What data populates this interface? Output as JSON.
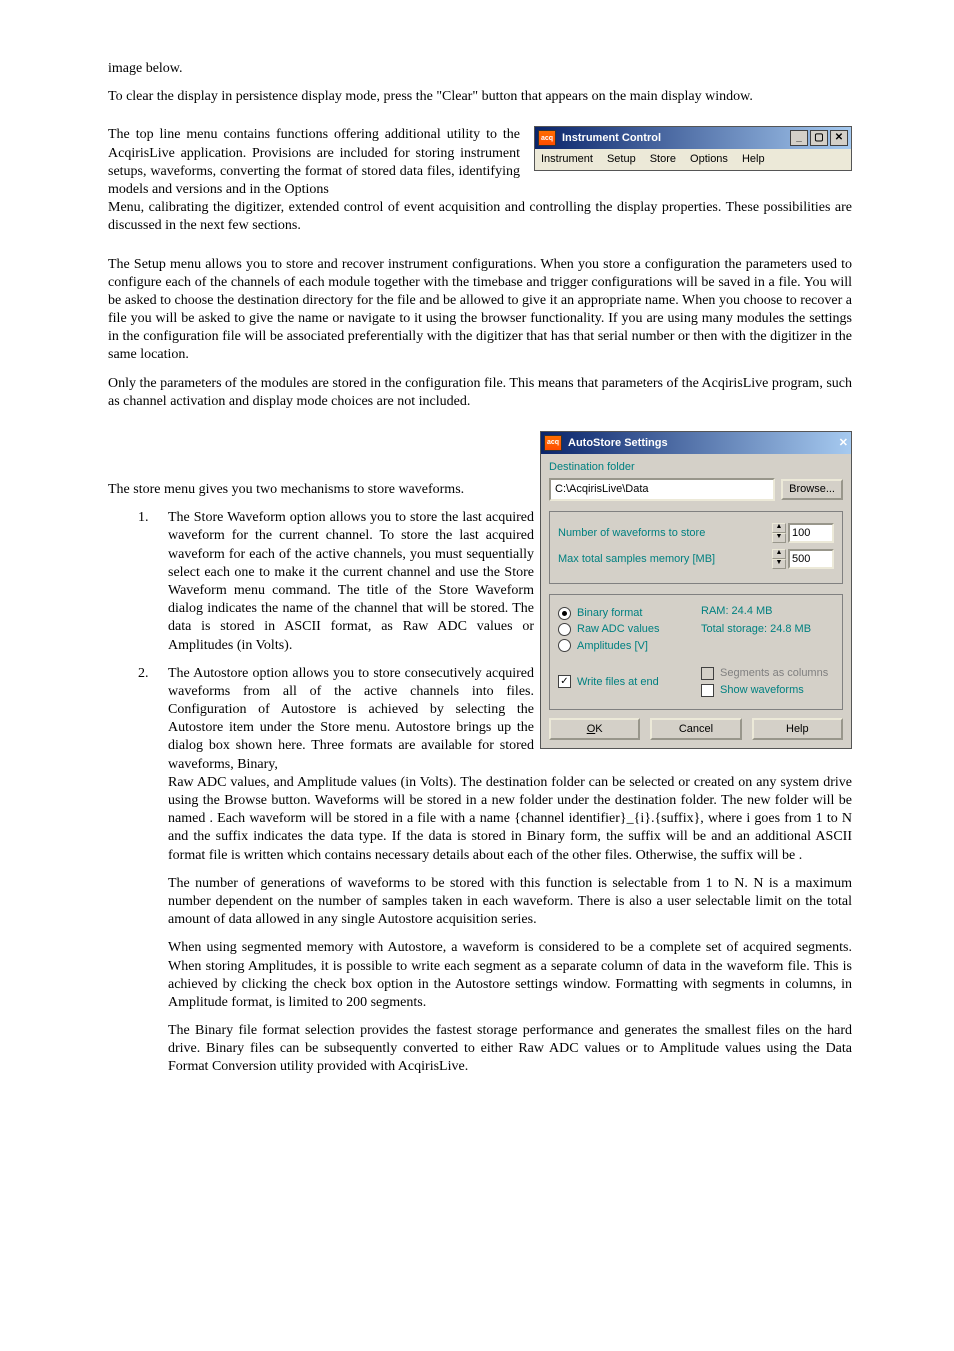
{
  "doc": {
    "p0": "image below.",
    "p1": "To clear the display in persistence display mode, press the \"Clear\" button that appears on the main display window.",
    "p2a": "The top line menu contains functions offering additional utility to the AcqirisLive application. Provisions are included for storing instrument setups, waveforms, converting the format of stored data files, identifying models and versions and in the Options",
    "p2b": "Menu, calibrating the digitizer, extended control of event acquisition and controlling the display properties. These possibilities are discussed in the next few sections.",
    "p3": "The Setup menu allows you to store and recover instrument configurations. When you store a configuration the parameters used to configure each of the channels of each module together with the timebase and trigger configurations will be saved in a file. You will be asked to choose the destination directory for the file and be allowed to give it an appropriate name. When you choose to recover a file you will be asked to give the name or navigate to it using the browser functionality. If you are using many modules the settings in the configuration file will be associated preferentially with the digitizer that has that serial number or then with the digitizer in the same location.",
    "p4": "Only the parameters of the modules are stored in the configuration file. This means that parameters of the AcqirisLive program, such as channel activation and display mode choices are not included.",
    "p5": "The store menu gives you two mechanisms to store waveforms.",
    "li1": "The Store Waveform option allows you to store the last acquired waveform for the current channel. To store the last acquired waveform for each of the active channels, you must sequentially select each one to make it the current channel and use the Store Waveform menu command. The title of the Store Waveform dialog indicates the name of the channel that will be stored. The data is stored in ASCII format, as Raw ADC values or Amplitudes (in Volts).",
    "li2a": "The Autostore option allows you to store consecutively acquired waveforms from all of the active channels into files. Configuration of Autostore is achieved by selecting the Autostore item under the Store menu. Autostore brings up the dialog box shown here. Three formats are available for stored waveforms, Binary,",
    "li2b": "Raw ADC values, and Amplitude values (in Volts). The destination folder can be selected or created on any system drive using the Browse button. Waveforms will be stored in a new folder under the destination folder. The new folder will be named                                         . Each waveform will be stored in a file with a name {channel identifier}_{i}.{suffix}, where i goes from 1 to N and the suffix indicates the data type. If the data is stored in Binary form, the suffix will be         and an additional ASCII format         file is written which contains necessary details about each of the other files. Otherwise, the suffix will be        .",
    "p6": "The number of generations of waveforms to be stored with this function is selectable from 1 to N. N is a maximum number dependent on the number of samples taken in each waveform. There is also a user selectable limit on the total amount of data allowed in any single Autostore acquisition series.",
    "p7": "When using segmented memory with Autostore, a waveform is considered to be a complete set of acquired segments. When storing Amplitudes, it is possible to write each segment as a separate column of data in the waveform file. This is achieved by clicking the check box option                                 in the Autostore settings window. Formatting with segments in columns, in Amplitude format, is limited to 200 segments.",
    "p8": "The Binary file format selection provides the fastest storage performance and generates the smallest files on the hard drive. Binary files can be subsequently converted to either Raw ADC values or to Amplitude values using the Data Format Conversion utility provided with AcqirisLive."
  },
  "ic": {
    "title": "Instrument Control",
    "menu": [
      "Instrument",
      "Setup",
      "Store",
      "Options",
      "Help"
    ]
  },
  "as": {
    "title": "AutoStore Settings",
    "dest_label": "Destination folder",
    "dest_value": "C:\\AcqirisLive\\Data",
    "browse": "Browse...",
    "num_label": "Number of waveforms to store",
    "num_value": "100",
    "max_label": "Max total samples memory [MB]",
    "max_value": "500",
    "radio_binary": "Binary format",
    "radio_raw": "Raw ADC values",
    "radio_amp": "Amplitudes [V]",
    "ram": "RAM: 24.4 MB",
    "total": "Total storage: 24.8 MB",
    "seg_cols": "Segments as columns",
    "write_end": "Write files at end",
    "show_wf": "Show waveforms",
    "ok_u": "O",
    "ok_rest": "K",
    "cancel": "Cancel",
    "help": "Help"
  }
}
